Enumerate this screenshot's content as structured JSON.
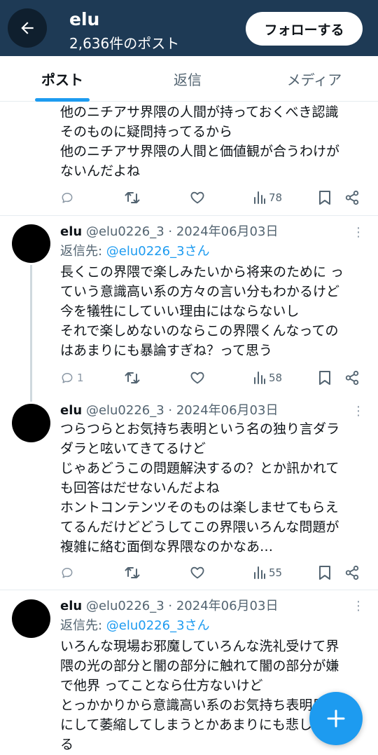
{
  "header": {
    "title": "elu",
    "post_count": "2,636件のポスト",
    "follow_label": "フォローする"
  },
  "tabs": [
    {
      "label": "ポスト"
    },
    {
      "label": "返信"
    },
    {
      "label": "メディア"
    }
  ],
  "posts": [
    {
      "text": "他のニチアサ界隈の人間が持っておくべき認識\nそのものに疑問持ってるから\n他のニチアサ界隈の人間と価値観が合うわけが\nないんだよね",
      "replies": "",
      "views": "78"
    },
    {
      "name": "elu",
      "handle_date": "@elu0226_3 · 2024年06月03日",
      "reply_prefix": "返信先: ",
      "reply_target": "@elu0226_3さん",
      "text": "長くこの界隈で楽しみたいから将来のために っ\nていう意識高い系の方々の言い分もわかるけど\n今を犠牲にしていい理由にはならないし\nそれで楽しめないのならこの界隈くんなっての\nはあまりにも暴論すぎね？って思う",
      "replies": "1",
      "views": "58"
    },
    {
      "name": "elu",
      "handle_date": "@elu0226_3 · 2024年06月03日",
      "text": "つらつらとお気持ち表明という名の独り言ダラ\nダラと呟いてきてるけど\nじゃあどうこの問題解決するの？とか訊かれて\nも回答はだせないんだよね\nホントコンテンツそのものは楽しませてもらえ\nてるんだけどどうしてこの界隈いろんな問題が\n複雑に絡む面倒な界隈なのかなあ…",
      "replies": "",
      "views": "55"
    },
    {
      "name": "elu",
      "handle_date": "@elu0226_3 · 2024年06月03日",
      "reply_prefix": "返信先: ",
      "reply_target": "@elu0226_3さん",
      "text": "いろんな現場お邪魔していろんな洗礼受けて界\n隈の光の部分と闇の部分に触れて闇の部分が嫌\nで他界 ってことなら仕方ないけど\nとっかかりから意識高い系のお気持ち表明目\nにして萎縮してしまうとかあまりにも悲しす\nる"
    }
  ],
  "icons": {
    "back": "arrow-left-icon",
    "reply": "reply-icon",
    "repost": "repost-icon",
    "like": "heart-icon",
    "views": "views-icon",
    "bookmark": "bookmark-icon",
    "share": "share-icon",
    "more": "more-icon",
    "compose": "plus-icon"
  },
  "colors": {
    "header_bg": "#1e3a55",
    "accent": "#1d9bf0",
    "text": "#0f1419",
    "secondary": "#536471"
  }
}
